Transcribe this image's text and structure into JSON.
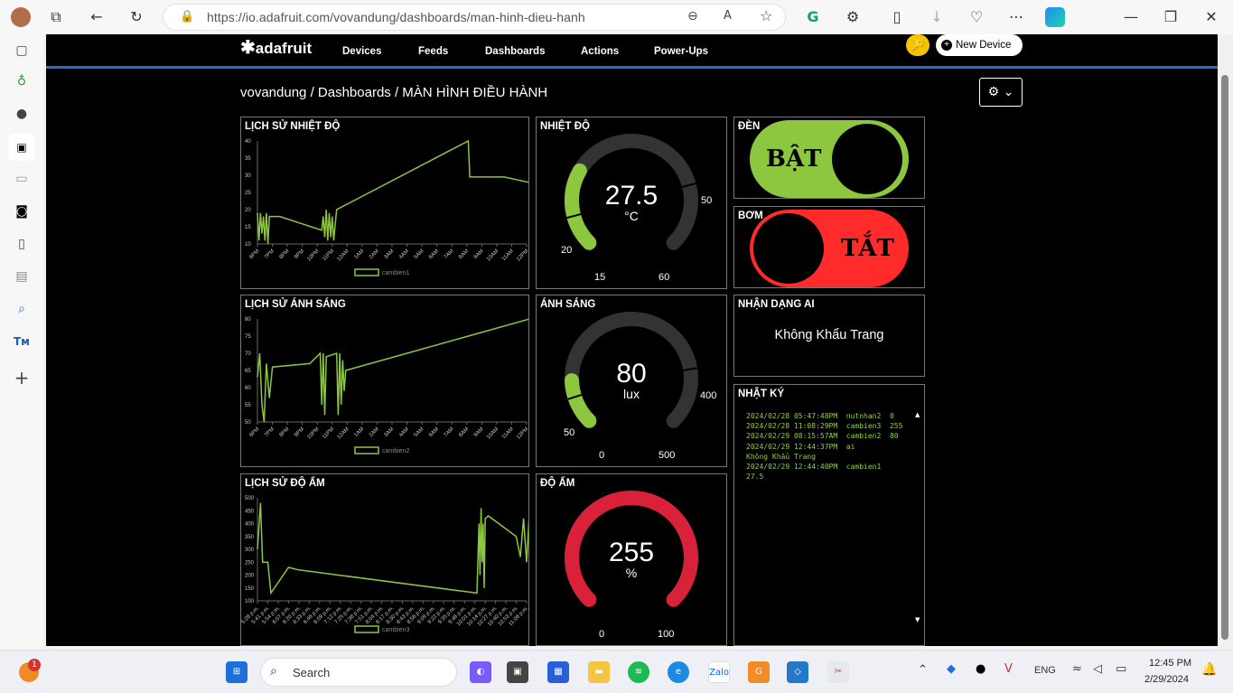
{
  "browser": {
    "url": "https://io.adafruit.com/vovandung/dashboards/man-hinh-dieu-hanh"
  },
  "site": {
    "logo_text": "adafruit",
    "nav": [
      "Devices",
      "Feeds",
      "Dashboards",
      "Actions",
      "Power-Ups"
    ],
    "new_device_label": "New Device",
    "breadcrumb": "vovandung / Dashboards / MÀN HÌNH ĐIỀU HÀNH"
  },
  "blocks": {
    "temp_chart": {
      "title": "LỊCH SỬ NHIỆT ĐỘ",
      "legend": "cambien1"
    },
    "light_chart": {
      "title": "LỊCH SỬ ÁNH SÁNG",
      "legend": "cambien2"
    },
    "humid_chart": {
      "title": "LỊCH SỬ ĐỘ ẨM",
      "legend": "cambien3"
    },
    "temp_gauge": {
      "title": "NHIỆT ĐỘ",
      "value": "27.5",
      "unit": "°C",
      "min": "15",
      "max": "60",
      "low": "20",
      "high": "50",
      "fraction": 0.278,
      "color": "#8dc63f"
    },
    "light_gauge": {
      "title": "ÁNH SÁNG",
      "value": "80",
      "unit": "lux",
      "min": "0",
      "max": "500",
      "low": "50",
      "high": "400",
      "fraction": 0.16,
      "color": "#8dc63f"
    },
    "humid_gauge": {
      "title": "ĐỘ ẨM",
      "value": "255",
      "unit": "%",
      "min": "0",
      "max": "100",
      "fraction": 1.0,
      "color": "#d9213a"
    },
    "light_toggle": {
      "title": "ĐÈN",
      "label": "BẬT",
      "state": "on",
      "color": "#8dc63f"
    },
    "pump_toggle": {
      "title": "BƠM",
      "label": "TẮT",
      "state": "off",
      "color": "#ff2a2a"
    },
    "ai": {
      "title": "NHẬN DẠNG AI",
      "text": "Không Khẩu Trang"
    },
    "log": {
      "title": "NHẬT KÝ",
      "lines": [
        "2024/02/28 05:47:48PM  nutnhan2  0",
        "2024/02/28 11:08:29PM  cambien3  255",
        "2024/02/29 08:15:57AM  cambien2  80",
        "2024/02/29 12:44:37PM  ai",
        "Không Khẩu Trang",
        "2024/02/29 12:44:40PM  cambien1",
        "27.5"
      ]
    }
  },
  "chart_data": [
    {
      "type": "line",
      "title": "LỊCH SỬ NHIỆT ĐỘ",
      "series": [
        {
          "name": "cambien1",
          "x": [
            "6PM",
            "7PM",
            "8PM",
            "9PM",
            "10PM",
            "11PM",
            "12AM",
            "1AM",
            "2AM",
            "3AM",
            "4AM",
            "5AM",
            "6AM",
            "7AM",
            "8AM",
            "9AM",
            "10AM",
            "11AM",
            "12PM"
          ]
        }
      ],
      "ylim": [
        10,
        40
      ],
      "yticks": [
        10,
        15,
        20,
        25,
        30,
        35,
        40
      ],
      "points": [
        [
          0,
          19
        ],
        [
          0.1,
          11
        ],
        [
          0.2,
          19
        ],
        [
          0.3,
          13
        ],
        [
          0.4,
          18
        ],
        [
          0.5,
          11
        ],
        [
          0.6,
          19
        ],
        [
          0.7,
          10
        ],
        [
          0.8,
          18
        ],
        [
          1.5,
          18
        ],
        [
          4.3,
          14
        ],
        [
          4.4,
          18
        ],
        [
          4.5,
          12
        ],
        [
          4.6,
          20
        ],
        [
          4.7,
          11
        ],
        [
          4.8,
          19
        ],
        [
          4.9,
          12
        ],
        [
          5.0,
          18
        ],
        [
          5.1,
          11
        ],
        [
          5.3,
          20
        ],
        [
          14.1,
          40
        ],
        [
          14.2,
          29.5
        ],
        [
          16.5,
          29.5
        ],
        [
          18.6,
          27.5
        ]
      ]
    },
    {
      "type": "line",
      "title": "LỊCH SỬ ÁNH SÁNG",
      "series": [
        {
          "name": "cambien2",
          "x": [
            "6PM",
            "7PM",
            "8PM",
            "9PM",
            "10PM",
            "11PM",
            "12AM",
            "1AM",
            "2AM",
            "3AM",
            "4AM",
            "5AM",
            "6AM",
            "7AM",
            "8AM",
            "9AM",
            "10AM",
            "11AM",
            "12PM"
          ]
        }
      ],
      "ylim": [
        50,
        80
      ],
      "yticks": [
        50,
        55,
        60,
        65,
        70,
        75,
        80
      ],
      "points": [
        [
          0,
          63
        ],
        [
          0.15,
          70
        ],
        [
          0.3,
          55
        ],
        [
          0.45,
          50
        ],
        [
          0.6,
          67
        ],
        [
          0.8,
          57
        ],
        [
          1.0,
          66
        ],
        [
          3.5,
          67
        ],
        [
          4.2,
          70
        ],
        [
          4.3,
          55
        ],
        [
          4.4,
          70
        ],
        [
          4.5,
          52
        ],
        [
          4.6,
          69
        ],
        [
          5.3,
          70
        ],
        [
          5.4,
          52
        ],
        [
          5.5,
          70
        ],
        [
          5.6,
          55
        ],
        [
          5.7,
          68
        ],
        [
          5.8,
          59
        ],
        [
          5.9,
          65
        ],
        [
          18.2,
          80
        ]
      ]
    },
    {
      "type": "line",
      "title": "LỊCH SỬ ĐỘ ẨM",
      "series": [
        {
          "name": "cambien3",
          "x": [
            "5:28 p.m.",
            "5:41 p.m.",
            "5:54 p.m.",
            "6:07 p.m.",
            "6:20 p.m.",
            "6:33 p.m.",
            "6:46 p.m.",
            "6:59 p.m.",
            "7:12 p.m.",
            "7:25 p.m.",
            "7:38 p.m.",
            "7:51 p.m.",
            "8:04 p.m.",
            "8:17 p.m.",
            "8:30 p.m.",
            "8:43 p.m.",
            "8:56 p.m.",
            "9:09 p.m.",
            "9:22 p.m.",
            "9:35 p.m.",
            "9:48 p.m.",
            "10:01 p.m.",
            "10:14 p.m.",
            "10:27 p.m.",
            "10:40 p.m.",
            "10:53 p.m.",
            "11:06 p.m."
          ]
        }
      ],
      "ylim": [
        100,
        500
      ],
      "yticks": [
        100,
        150,
        200,
        250,
        300,
        350,
        400,
        450,
        500
      ],
      "points": [
        [
          0,
          300
        ],
        [
          0.3,
          480
        ],
        [
          0.5,
          250
        ],
        [
          1.0,
          250
        ],
        [
          1.3,
          130
        ],
        [
          3.0,
          230
        ],
        [
          4.0,
          220
        ],
        [
          21.2,
          130
        ],
        [
          21.4,
          400
        ],
        [
          21.5,
          200
        ],
        [
          21.6,
          460
        ],
        [
          21.7,
          250
        ],
        [
          21.8,
          400
        ],
        [
          21.9,
          150
        ],
        [
          22.0,
          420
        ],
        [
          22.3,
          430
        ],
        [
          25.0,
          350
        ],
        [
          25.4,
          270
        ],
        [
          25.7,
          420
        ],
        [
          26.0,
          250
        ],
        [
          26.3,
          460
        ],
        [
          26.5,
          180
        ]
      ]
    }
  ]
}
